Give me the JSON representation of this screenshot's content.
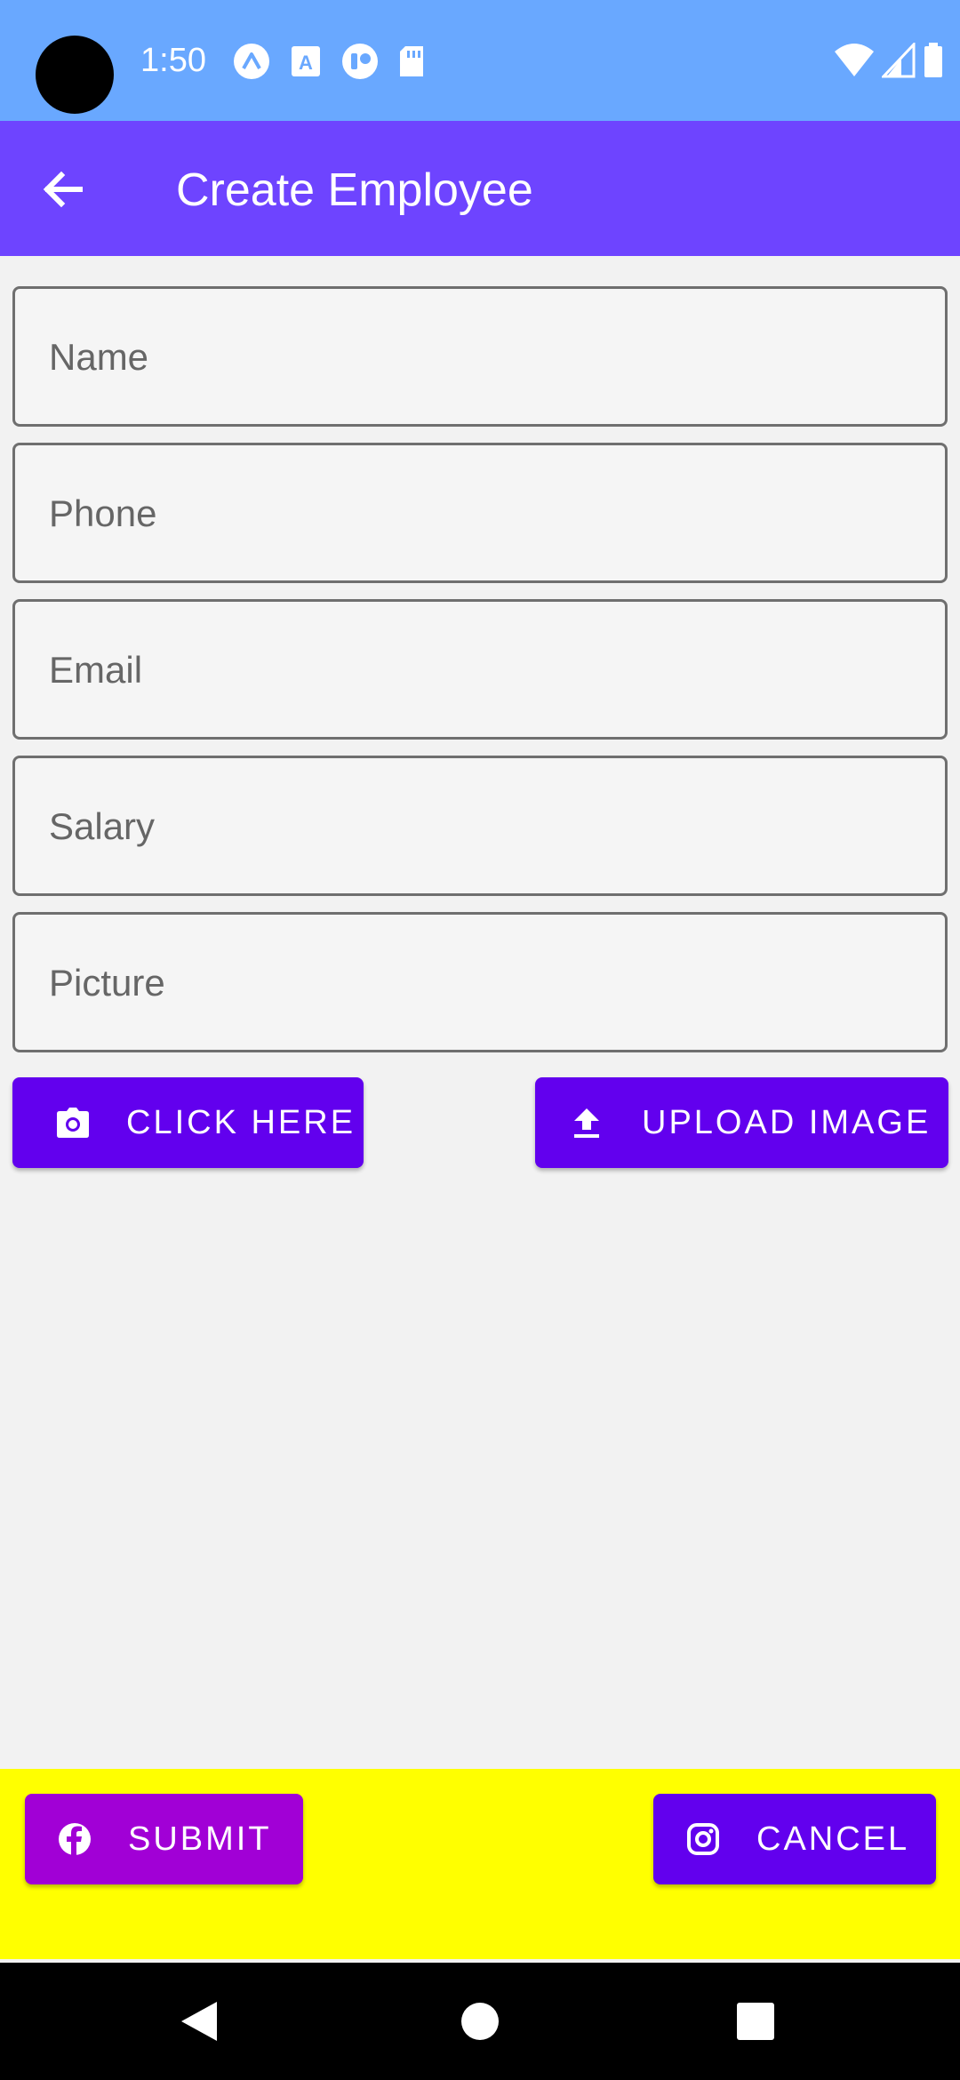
{
  "status_bar": {
    "time": "1:50",
    "notification_icons": [
      "expo-icon",
      "font-a-icon",
      "notification-app-icon",
      "sd-card-icon"
    ],
    "system_icons": [
      "wifi-icon",
      "signal-icon",
      "battery-icon"
    ]
  },
  "app_bar": {
    "title": "Create Employee",
    "back_icon": "arrow-back-icon",
    "color": "#6e44ff"
  },
  "form": {
    "fields": [
      {
        "name": "name",
        "placeholder": "Name",
        "value": ""
      },
      {
        "name": "phone",
        "placeholder": "Phone",
        "value": ""
      },
      {
        "name": "email",
        "placeholder": "Email",
        "value": ""
      },
      {
        "name": "salary",
        "placeholder": "Salary",
        "value": ""
      },
      {
        "name": "picture",
        "placeholder": "Picture",
        "value": ""
      }
    ]
  },
  "actions": {
    "click_here": {
      "label": "CLICK HERE",
      "icon": "camera-icon",
      "color": "#6200ee"
    },
    "upload_image": {
      "label": "UPLOAD IMAGE",
      "icon": "upload-icon",
      "color": "#6200ee"
    }
  },
  "footer": {
    "background": "#ffff00",
    "submit": {
      "label": "SUBMIT",
      "icon": "facebook-icon",
      "color": "#a100d6"
    },
    "cancel": {
      "label": "CANCEL",
      "icon": "instagram-icon",
      "color": "#6200ee"
    }
  },
  "nav_bar": {
    "items": [
      "back-triangle-icon",
      "home-circle-icon",
      "recents-square-icon"
    ]
  }
}
